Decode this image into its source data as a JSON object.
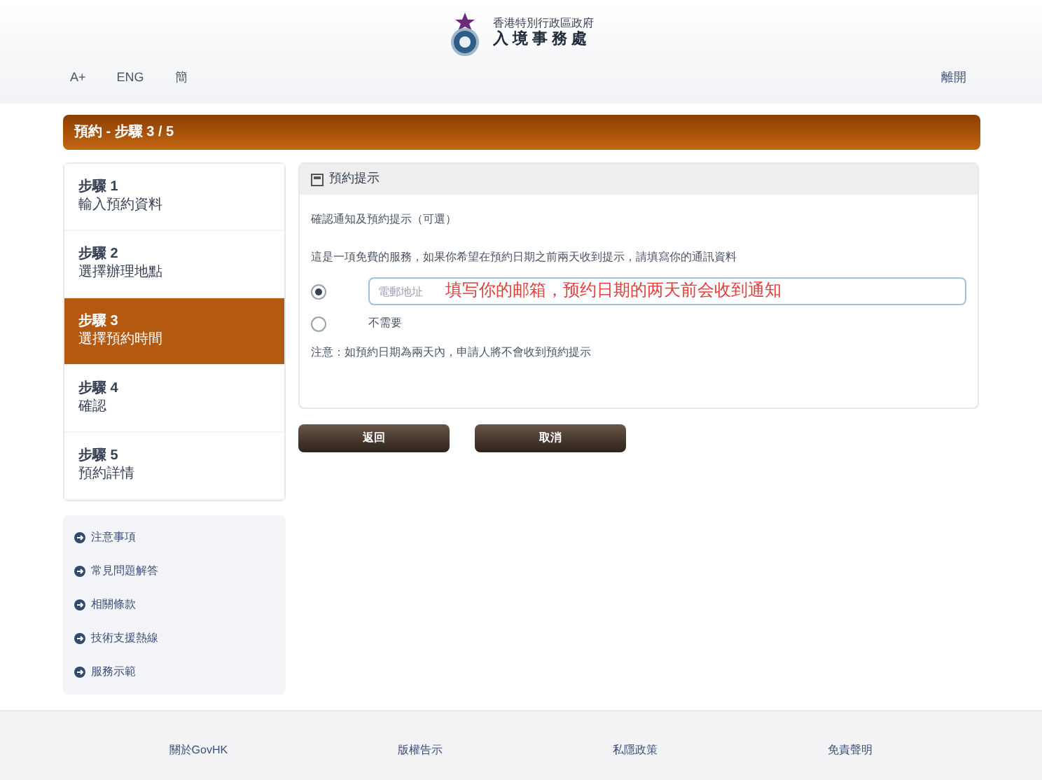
{
  "header": {
    "org_line_1": "香港特別行政區政府",
    "org_line_2": "入 境 事 務 處"
  },
  "top_nav": {
    "items": [
      "A+",
      "ENG",
      "簡"
    ],
    "right_link": "離開"
  },
  "title_bar": "預約 - 步驟 3 / 5",
  "steps": [
    {
      "label": "步驟 1",
      "name": "輸入預約資料",
      "selected": false
    },
    {
      "label": "步驟 2",
      "name": "選擇辦理地點",
      "selected": false
    },
    {
      "label": "步驟 3",
      "name": "選擇預約時間",
      "selected": true
    },
    {
      "label": "步驟 4",
      "name": "確認",
      "selected": false
    },
    {
      "label": "步驟 5",
      "name": "預約詳情",
      "selected": false
    }
  ],
  "links": [
    "注意事項",
    "常見問題解答",
    "相關條款",
    "技術支援熱線",
    "服務示範"
  ],
  "panel": {
    "title": "預約提示",
    "subtitle": "確認通知及預約提示（可選）",
    "description": "這是一項免費的服務，如果你希望在預約日期之前兩天收到提示，請填寫你的通訊資料",
    "options": [
      {
        "kind": "field",
        "placeholder": "電郵地址",
        "selected": true
      },
      {
        "kind": "label",
        "label": "不需要",
        "selected": false
      }
    ],
    "note": "注意：如預約日期為兩天內，申請人將不會收到預約提示"
  },
  "annotation": "填写你的邮箱，预约日期的两天前会收到通知",
  "buttons": [
    "返回",
    "取消"
  ],
  "footer": [
    "關於GovHK",
    "版權告示",
    "私隱政策",
    "免責聲明"
  ]
}
